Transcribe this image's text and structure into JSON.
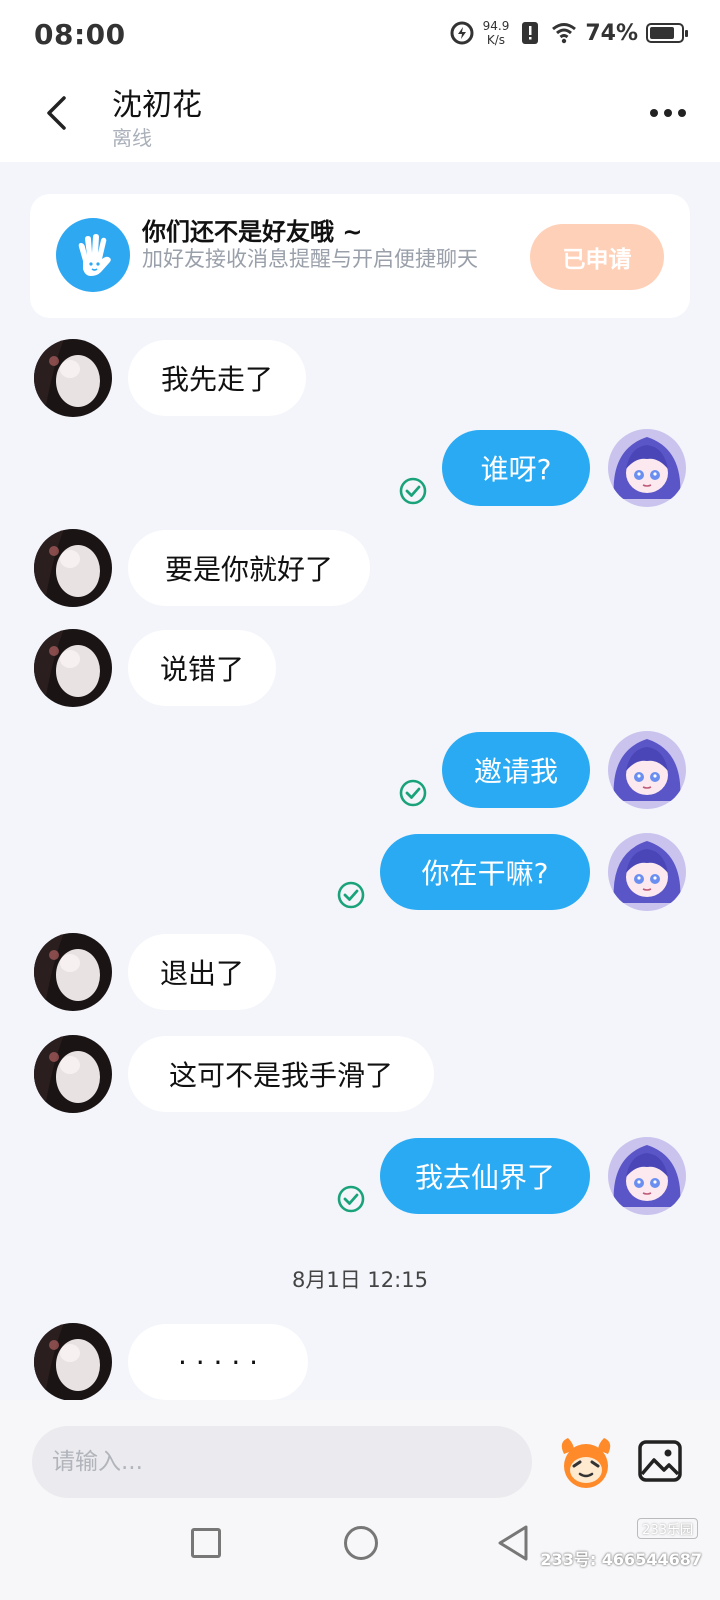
{
  "status_bar": {
    "time": "08:00",
    "net_speed_value": "94.9",
    "net_speed_unit": "K/s",
    "battery": "74%"
  },
  "header": {
    "contact_name": "沈初花",
    "contact_status": "离线"
  },
  "friend_banner": {
    "title": "你们还不是好友哦 ~",
    "subtitle": "加好友接收消息提醒与开启便捷聊天",
    "button_label": "已申请"
  },
  "messages": [
    {
      "from": "them",
      "text": "我先走了"
    },
    {
      "from": "me",
      "text": "谁呀?"
    },
    {
      "from": "them",
      "text": "要是你就好了"
    },
    {
      "from": "them",
      "text": "说错了"
    },
    {
      "from": "me",
      "text": "邀请我"
    },
    {
      "from": "me",
      "text": "你在干嘛?"
    },
    {
      "from": "them",
      "text": "退出了"
    },
    {
      "from": "them",
      "text": "这可不是我手滑了"
    },
    {
      "from": "me",
      "text": "我去仙界了"
    },
    {
      "from": "them",
      "text": "· · · · ·"
    }
  ],
  "timestamp": "8月1日 12:15",
  "input": {
    "placeholder": "请输入..."
  },
  "watermark": {
    "logo": "233乐园",
    "text": "233号: 466544687"
  },
  "colors": {
    "outgoing_bubble": "#2aaaf3",
    "incoming_bubble": "#ffffff",
    "read_check": "#1aa37a",
    "applied_button": "#ffd0b8",
    "banner_icon": "#2fa8f2"
  }
}
